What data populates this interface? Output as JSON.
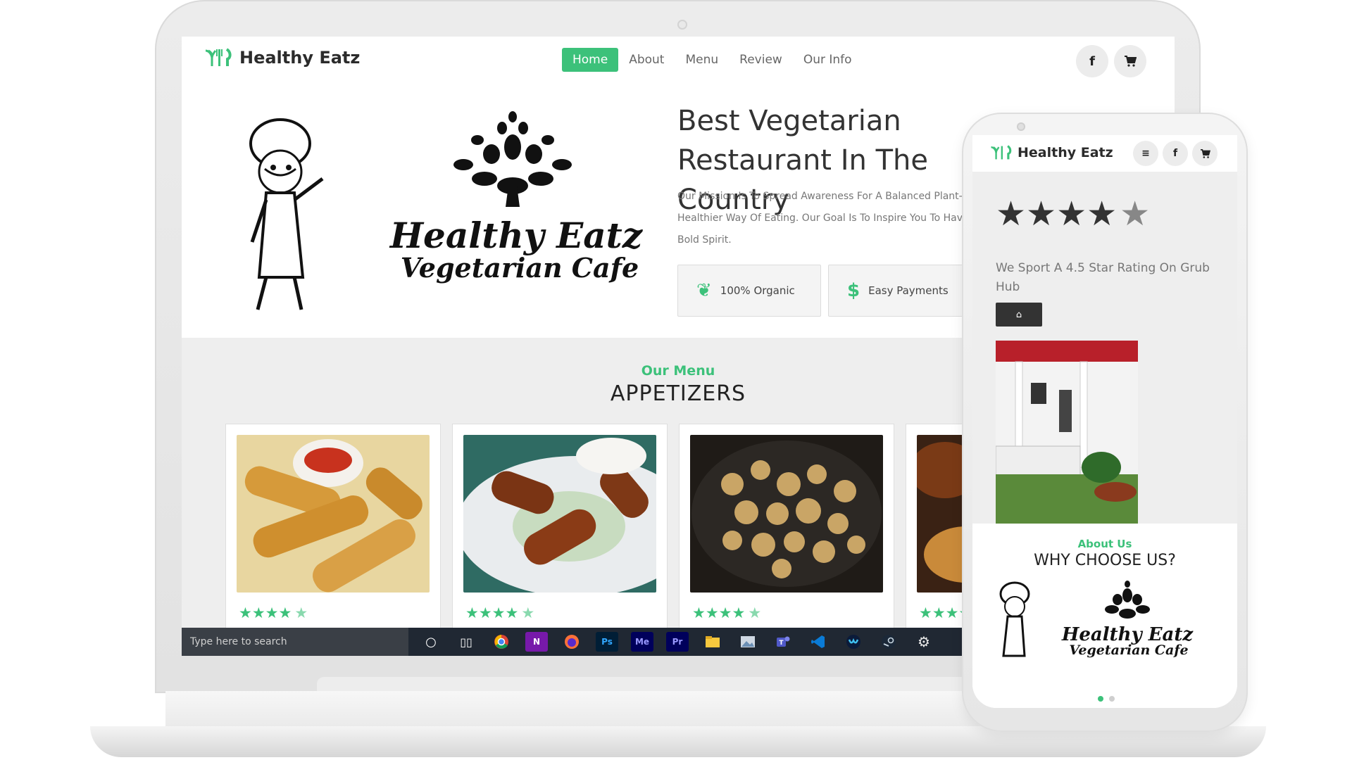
{
  "site": {
    "brand": "Healthy Eatz",
    "nav": [
      "Home",
      "About",
      "Menu",
      "Review",
      "Our Info"
    ],
    "active_nav": "Home",
    "facebook_icon": "f",
    "cart_icon": "🛒"
  },
  "hero": {
    "headline": "Best Vegetarian Restaurant In The Country",
    "mission": "Our Mission Is To Spread Awareness For A Balanced Plant-Based, Healthier Way Of Eating. Our Goal Is To Inspire You To Have A Healthy And Bold Spirit.",
    "art_title": "Healthy Eatz",
    "art_subtitle": "Vegetarian Cafe",
    "features": [
      {
        "label": "100% Organic",
        "icon": "leaf-icon"
      },
      {
        "label": "Easy Payments",
        "icon": "dollar-icon"
      }
    ]
  },
  "menu_section": {
    "kicker": "Our Menu",
    "title": "APPETIZERS",
    "cards": [
      {
        "image": "mozzarella-sticks-image",
        "rating": 4.5
      },
      {
        "image": "fried-cutlets-image",
        "rating": 4.5
      },
      {
        "image": "mushrooms-image",
        "rating": 4.5
      },
      {
        "image": "fried-dumplings-image",
        "rating": 4.5
      }
    ]
  },
  "taskbar": {
    "search_placeholder": "Type here to search",
    "apps": [
      "cortana",
      "task-view",
      "chrome",
      "onenote",
      "firefox",
      "photoshop",
      "media-encoder",
      "premiere",
      "file-explorer",
      "photos",
      "teams",
      "vscode",
      "webex",
      "steam",
      "settings"
    ],
    "labels": {
      "onenote": "N",
      "photoshop": "Ps",
      "media_encoder": "Me",
      "premiere": "Pr"
    }
  },
  "mobile": {
    "brand": "Healthy Eatz",
    "menu_icon": "≡",
    "rating_stars": 4.5,
    "rating_text": "We Sport A 4.5 Star Rating On Grub Hub",
    "home_icon": "⌂",
    "about_kicker": "About Us",
    "about_title": "WHY CHOOSE US?",
    "art_title": "Healthy Eatz",
    "art_subtitle": "Vegetarian Cafe"
  },
  "colors": {
    "accent": "#3cc17a",
    "dark": "#333333",
    "section_bg": "#eeeeee"
  }
}
